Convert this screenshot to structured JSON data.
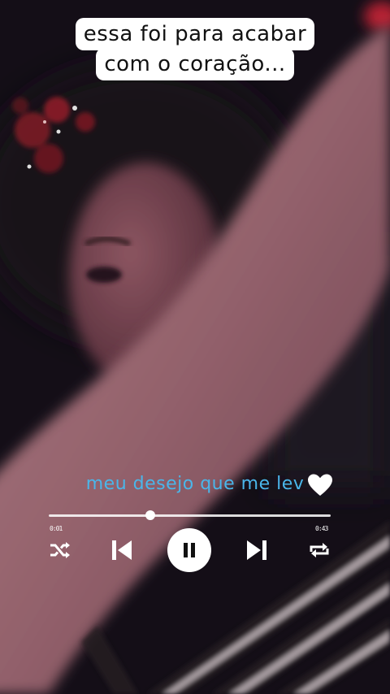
{
  "caption": {
    "line1": "essa foi para acabar",
    "line2": "com o coração..."
  },
  "lyric": "meu desejo que me lev",
  "player": {
    "progress": 0.36,
    "elapsed": "0:01",
    "remaining": "0:43",
    "state": "playing",
    "icons": [
      "shuffle-icon",
      "previous-icon",
      "pause-icon",
      "next-icon",
      "repeat-icon"
    ]
  },
  "colors": {
    "lyric": "#4ab6ea",
    "caption_bg": "#ffffff",
    "controls": "#ffffff"
  }
}
